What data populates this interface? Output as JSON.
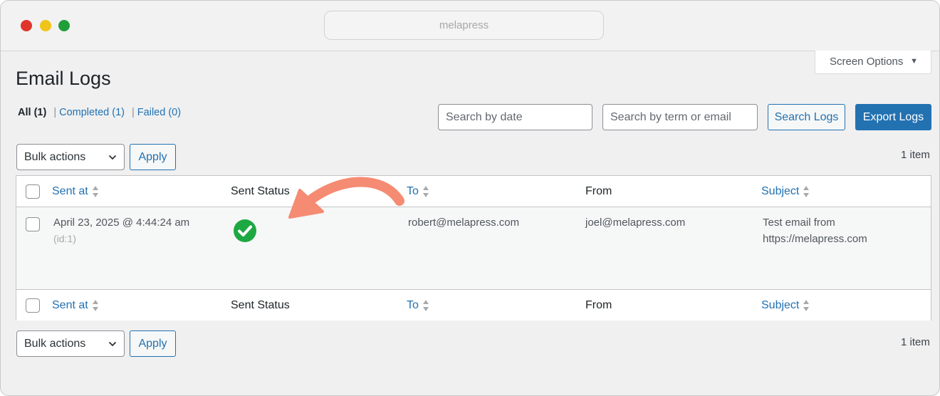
{
  "browser": {
    "url": "melapress"
  },
  "screen_options": {
    "label": "Screen Options",
    "caret": "▼"
  },
  "page": {
    "title": "Email Logs"
  },
  "filters": {
    "all": "All",
    "all_count": "(1)",
    "completed": "Completed (1)",
    "failed": "Failed (0)",
    "separator": "|"
  },
  "search": {
    "date_placeholder": "Search by date",
    "term_placeholder": "Search by term or email",
    "search_button": "Search Logs",
    "export_button": "Export Logs"
  },
  "bulk": {
    "label": "Bulk actions",
    "apply": "Apply",
    "count": "1 item"
  },
  "table": {
    "columns": [
      "Sent at",
      "Sent Status",
      "To",
      "From",
      "Subject"
    ],
    "rows": [
      {
        "sent_at": "April 23, 2025 @ 4:44:24 am",
        "id": "(id:1)",
        "status": "sent",
        "to": "robert@melapress.com",
        "from": "joel@melapress.com",
        "subject_line1": "Test email from",
        "subject_line2": "https://melapress.com"
      }
    ]
  },
  "colors": {
    "accent": "#2271b1",
    "success": "#1ea843",
    "annotation_arrow": "#f58b73"
  },
  "icons": {
    "sort": "sort-arrows-icon",
    "status": "check-circle-icon",
    "select_caret": "chevron-down-icon"
  }
}
